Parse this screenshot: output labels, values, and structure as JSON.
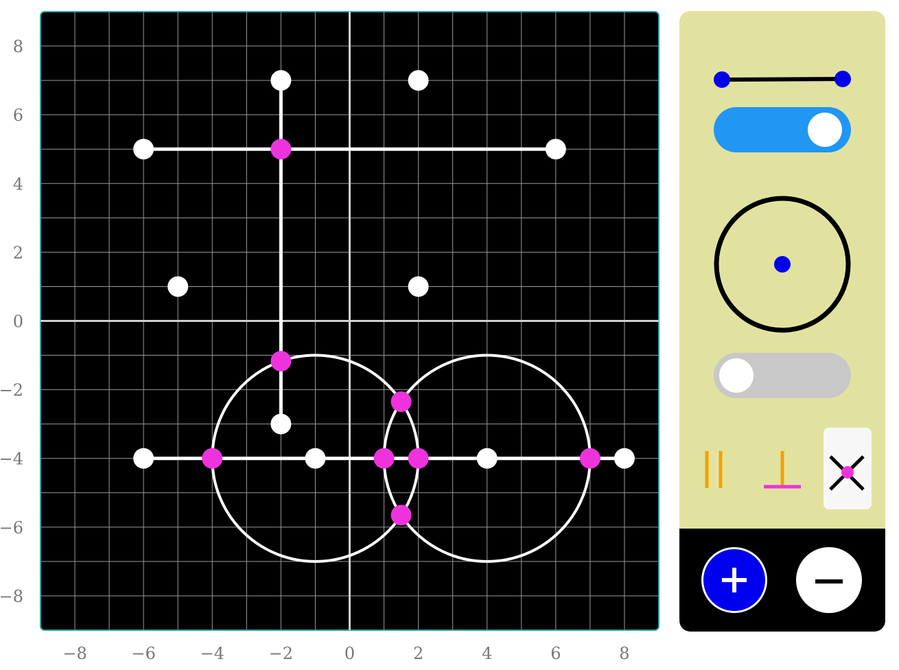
{
  "board": {
    "background": "#000000",
    "grid_color": "#9a9a9a",
    "axis_color": "#cfcfcf",
    "x_range": [
      -9,
      9
    ],
    "y_range": [
      -9,
      9
    ],
    "x_ticks": [
      "−8",
      "−6",
      "−4",
      "−2",
      "0",
      "2",
      "4",
      "6",
      "8"
    ],
    "y_ticks": [
      "8",
      "6",
      "4",
      "2",
      "0",
      "−2",
      "−4",
      "−6",
      "−8"
    ],
    "free_point_color": "#ffffff",
    "intersection_color": "#ee33dd",
    "free_points": [
      [
        -2,
        7
      ],
      [
        2,
        7
      ],
      [
        -6,
        5
      ],
      [
        6,
        5
      ],
      [
        -5,
        1
      ],
      [
        2,
        1
      ],
      [
        -2,
        -3
      ],
      [
        -6,
        -4
      ],
      [
        -1,
        -4
      ],
      [
        4,
        -4
      ],
      [
        8,
        -4
      ]
    ],
    "segments": [
      [
        [
          -2,
          7
        ],
        [
          -2,
          -3
        ]
      ],
      [
        [
          -6,
          5
        ],
        [
          6,
          5
        ]
      ],
      [
        [
          -6,
          -4
        ],
        [
          8,
          -4
        ]
      ]
    ],
    "circles": [
      {
        "center": [
          -1,
          -4
        ],
        "radius": 3
      },
      {
        "center": [
          4,
          -4
        ],
        "radius": 3
      }
    ],
    "intersection_points": [
      [
        -2,
        5
      ],
      [
        -2,
        -1.17
      ],
      [
        1.5,
        -2.35
      ],
      [
        1.5,
        -5.65
      ],
      [
        -4,
        -4
      ],
      [
        1,
        -4
      ],
      [
        2,
        -4
      ],
      [
        7,
        -4
      ]
    ]
  },
  "panel": {
    "background": "#e2e2a0",
    "segment_tool": {
      "endpoint_color": "#0000ee",
      "line_color": "#000000"
    },
    "segment_toggle": {
      "on": true,
      "color": "#2196f3"
    },
    "circle_tool": {
      "stroke": "#000000",
      "center_color": "#0000ee"
    },
    "circle_toggle": {
      "on": false,
      "color": "#c8c8c8"
    },
    "constraints": [
      {
        "name": "parallel",
        "color": "#f5a000",
        "selected": false
      },
      {
        "name": "perpendicular",
        "color": "#f5a000",
        "base_color": "#ee33dd",
        "selected": false
      },
      {
        "name": "intersection",
        "color": "#000000",
        "dot_color": "#ee33dd",
        "selected": true
      }
    ],
    "zoom": {
      "background": "#000000",
      "plus_color": "#0000ee",
      "minus_color": "#ffffff"
    }
  }
}
